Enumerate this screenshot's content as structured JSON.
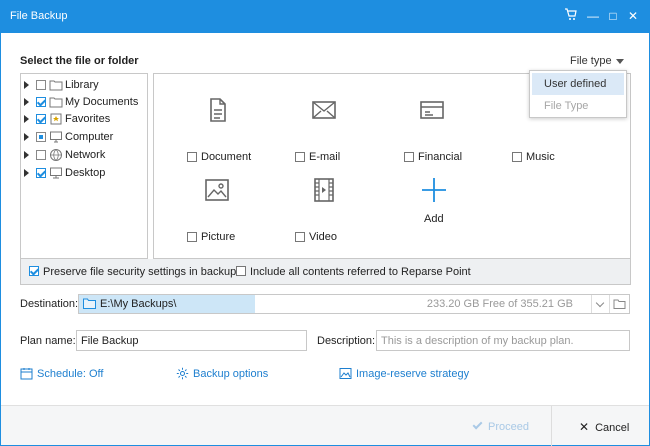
{
  "window": {
    "title": "File Backup",
    "controls": {
      "cart_icon": "cart-icon",
      "minimize": "—",
      "maximize": "□",
      "close": "✕"
    }
  },
  "section_title": "Select the file or folder",
  "file_type": {
    "label": "File type",
    "options": [
      "User defined",
      "File Type"
    ],
    "selected": "User defined"
  },
  "tree": [
    {
      "label": "Library",
      "state": "unchecked",
      "icon": "folder-icon"
    },
    {
      "label": "My Documents",
      "state": "checked",
      "icon": "folder-icon"
    },
    {
      "label": "Favorites",
      "state": "checked",
      "icon": "favorites-icon"
    },
    {
      "label": "Computer",
      "state": "partial",
      "icon": "computer-icon"
    },
    {
      "label": "Network",
      "state": "unchecked",
      "icon": "network-icon"
    },
    {
      "label": "Desktop",
      "state": "checked",
      "icon": "desktop-icon"
    }
  ],
  "file_types": [
    {
      "label": "Document",
      "icon": "document-icon"
    },
    {
      "label": "E-mail",
      "icon": "email-icon"
    },
    {
      "label": "Financial",
      "icon": "financial-icon"
    },
    {
      "label": "Music",
      "icon": "music-icon"
    },
    {
      "label": "Picture",
      "icon": "picture-icon"
    },
    {
      "label": "Video",
      "icon": "video-icon"
    },
    {
      "label": "Add",
      "icon": "add-icon"
    }
  ],
  "options": {
    "preserve_security": "Preserve file security settings in backup",
    "preserve_security_checked": true,
    "include_reparse": "Include all contents referred to Reparse Point",
    "include_reparse_checked": false
  },
  "destination": {
    "label": "Destination:",
    "path": "E:\\My Backups\\",
    "free_space": "233.20 GB Free of 355.21 GB"
  },
  "plan": {
    "name_label": "Plan name:",
    "name_value": "File Backup",
    "description_label": "Description:",
    "description_placeholder": "This is a description of my backup plan."
  },
  "links": {
    "schedule": "Schedule: Off",
    "backup_options": "Backup options",
    "image_reserve": "Image-reserve strategy"
  },
  "footer": {
    "proceed": "Proceed",
    "cancel": "Cancel"
  },
  "colors": {
    "accent": "#1e8ee0",
    "link": "#1e7fcf",
    "disabled": "#a9c9e6"
  }
}
